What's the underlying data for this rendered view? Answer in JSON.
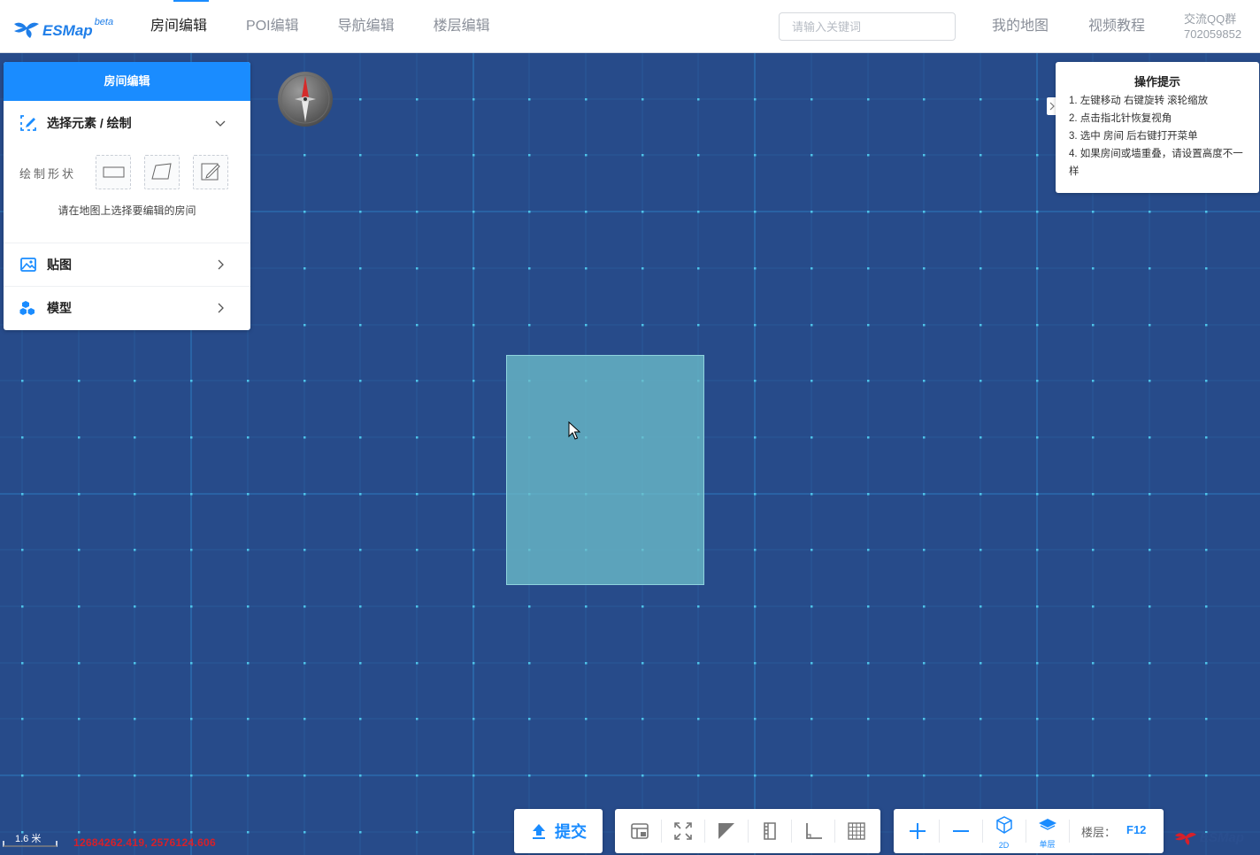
{
  "header": {
    "logo_text": "ESMap",
    "logo_sup": "beta",
    "nav": [
      {
        "label": "房间编辑"
      },
      {
        "label": "POI编辑"
      },
      {
        "label": "导航编辑"
      },
      {
        "label": "楼层编辑"
      }
    ],
    "search_placeholder": "请输入关键词",
    "my_map": "我的地图",
    "video": "视频教程",
    "qq_label": "交流QQ群",
    "qq_number": "702059852"
  },
  "panel": {
    "title": "房间编辑",
    "select_section": "选择元素 / 绘制",
    "shape_label": "绘制形状",
    "hint": "请在地图上选择要编辑的房间",
    "texture_section": "贴图",
    "model_section": "模型"
  },
  "tips": {
    "title": "操作提示",
    "lines": [
      "1. 左键移动 右键旋转 滚轮缩放",
      "2. 点击指北针恢复视角",
      "3. 选中 房间 后右键打开菜单",
      "4. 如果房间或墙重叠，请设置高度不一样"
    ]
  },
  "toolbar": {
    "submit": "提交",
    "view_2d": "2D",
    "single_floor": "单层",
    "floor_label": "楼层：",
    "floor_value": "F12"
  },
  "status": {
    "scale": "1.6 米",
    "coords": "12684262.419, 2576124.606"
  },
  "colors": {
    "map_bg": "#274b8a",
    "grid": "#2f86c9",
    "accent": "#1a8cff",
    "room": "#6cbdc9",
    "coords": "#d6202a"
  }
}
